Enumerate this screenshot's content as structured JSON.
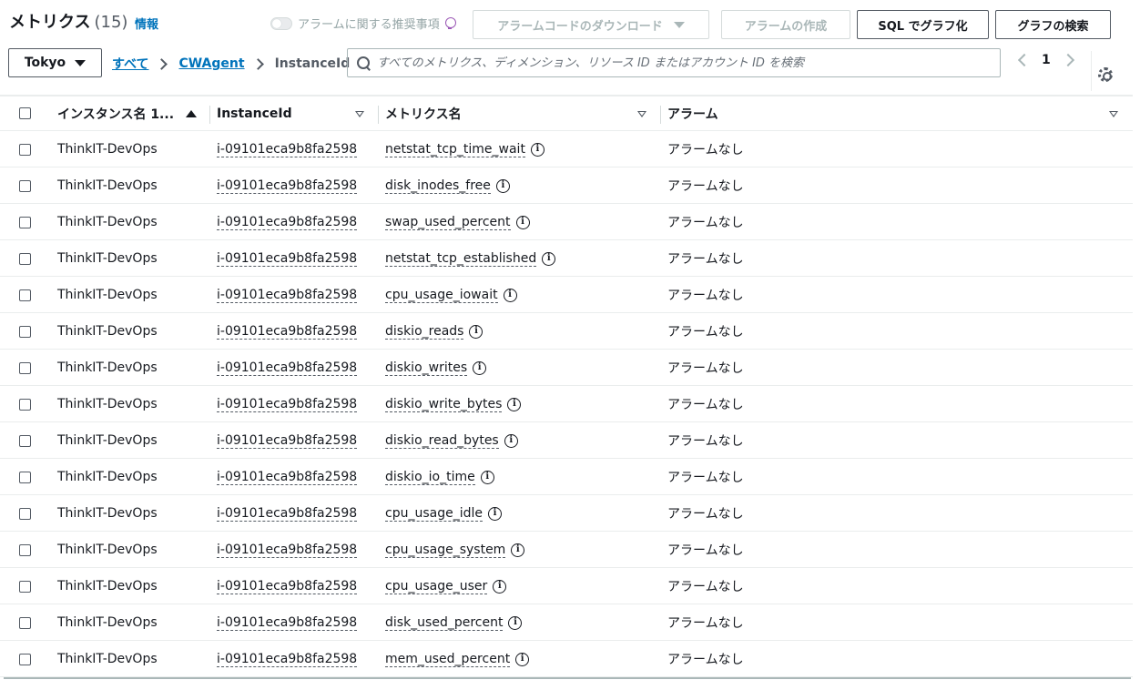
{
  "header": {
    "title": "メトリクス",
    "count": "(15)",
    "info": "情報",
    "toggle_label": "アラームに関する推奨事項",
    "download_label": "アラームコードのダウンロード",
    "create_alarm_label": "アラームの作成",
    "sql_graph_label": "SQL でグラフ化",
    "browse_graph_label": "グラフの検索"
  },
  "filters": {
    "region": "Tokyo",
    "breadcrumb": [
      "すべて",
      "CWAgent",
      "InstanceId"
    ],
    "search_placeholder": "すべてのメトリクス、ディメンション、リソース ID またはアカウント ID を検索",
    "page": "1"
  },
  "table": {
    "columns": [
      "インスタンス名 1...",
      "InstanceId",
      "メトリクス名",
      "アラーム"
    ],
    "rows": [
      {
        "instance_name": "ThinkIT-DevOps",
        "instance_id": "i-09101eca9b8fa2598",
        "metric": "netstat_tcp_time_wait",
        "alarm": "アラームなし"
      },
      {
        "instance_name": "ThinkIT-DevOps",
        "instance_id": "i-09101eca9b8fa2598",
        "metric": "disk_inodes_free",
        "alarm": "アラームなし"
      },
      {
        "instance_name": "ThinkIT-DevOps",
        "instance_id": "i-09101eca9b8fa2598",
        "metric": "swap_used_percent",
        "alarm": "アラームなし"
      },
      {
        "instance_name": "ThinkIT-DevOps",
        "instance_id": "i-09101eca9b8fa2598",
        "metric": "netstat_tcp_established",
        "alarm": "アラームなし"
      },
      {
        "instance_name": "ThinkIT-DevOps",
        "instance_id": "i-09101eca9b8fa2598",
        "metric": "cpu_usage_iowait",
        "alarm": "アラームなし"
      },
      {
        "instance_name": "ThinkIT-DevOps",
        "instance_id": "i-09101eca9b8fa2598",
        "metric": "diskio_reads",
        "alarm": "アラームなし"
      },
      {
        "instance_name": "ThinkIT-DevOps",
        "instance_id": "i-09101eca9b8fa2598",
        "metric": "diskio_writes",
        "alarm": "アラームなし"
      },
      {
        "instance_name": "ThinkIT-DevOps",
        "instance_id": "i-09101eca9b8fa2598",
        "metric": "diskio_write_bytes",
        "alarm": "アラームなし"
      },
      {
        "instance_name": "ThinkIT-DevOps",
        "instance_id": "i-09101eca9b8fa2598",
        "metric": "diskio_read_bytes",
        "alarm": "アラームなし"
      },
      {
        "instance_name": "ThinkIT-DevOps",
        "instance_id": "i-09101eca9b8fa2598",
        "metric": "diskio_io_time",
        "alarm": "アラームなし"
      },
      {
        "instance_name": "ThinkIT-DevOps",
        "instance_id": "i-09101eca9b8fa2598",
        "metric": "cpu_usage_idle",
        "alarm": "アラームなし"
      },
      {
        "instance_name": "ThinkIT-DevOps",
        "instance_id": "i-09101eca9b8fa2598",
        "metric": "cpu_usage_system",
        "alarm": "アラームなし"
      },
      {
        "instance_name": "ThinkIT-DevOps",
        "instance_id": "i-09101eca9b8fa2598",
        "metric": "cpu_usage_user",
        "alarm": "アラームなし"
      },
      {
        "instance_name": "ThinkIT-DevOps",
        "instance_id": "i-09101eca9b8fa2598",
        "metric": "disk_used_percent",
        "alarm": "アラームなし"
      },
      {
        "instance_name": "ThinkIT-DevOps",
        "instance_id": "i-09101eca9b8fa2598",
        "metric": "mem_used_percent",
        "alarm": "アラームなし"
      }
    ]
  },
  "icons": {
    "search": "search-icon",
    "settings": "gear-icon",
    "info": "info-icon",
    "recommendation": "lightbulb-icon"
  },
  "colors": {
    "link": "#0073bb",
    "text": "#16191f",
    "disabled": "#aab7b8"
  }
}
